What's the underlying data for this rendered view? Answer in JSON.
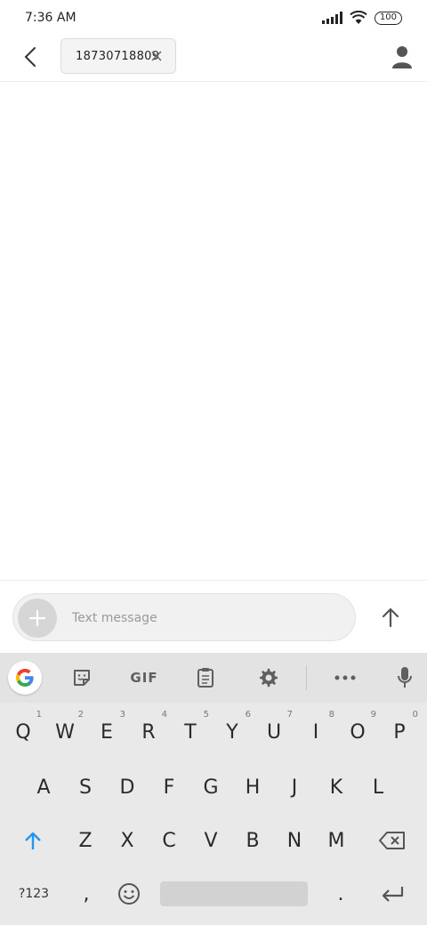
{
  "status_bar": {
    "time": "7:36 AM",
    "battery": "100"
  },
  "header": {
    "recipient": "18730718809"
  },
  "compose": {
    "placeholder": "Text message"
  },
  "keyboard": {
    "toolbar": {
      "gif_label": "GIF"
    },
    "row1": [
      {
        "label": "Q",
        "hint": "1"
      },
      {
        "label": "W",
        "hint": "2"
      },
      {
        "label": "E",
        "hint": "3"
      },
      {
        "label": "R",
        "hint": "4"
      },
      {
        "label": "T",
        "hint": "5"
      },
      {
        "label": "Y",
        "hint": "6"
      },
      {
        "label": "U",
        "hint": "7"
      },
      {
        "label": "I",
        "hint": "8"
      },
      {
        "label": "O",
        "hint": "9"
      },
      {
        "label": "P",
        "hint": "0"
      }
    ],
    "row2": [
      "A",
      "S",
      "D",
      "F",
      "G",
      "H",
      "J",
      "K",
      "L"
    ],
    "row3": [
      "Z",
      "X",
      "C",
      "V",
      "B",
      "N",
      "M"
    ],
    "symbols_label": "?123",
    "comma": ",",
    "period": "."
  },
  "colors": {
    "shift_accent": "#2196f3",
    "key_bg": "#e9e9e9",
    "toolbar_bg": "#e3e3e3"
  }
}
